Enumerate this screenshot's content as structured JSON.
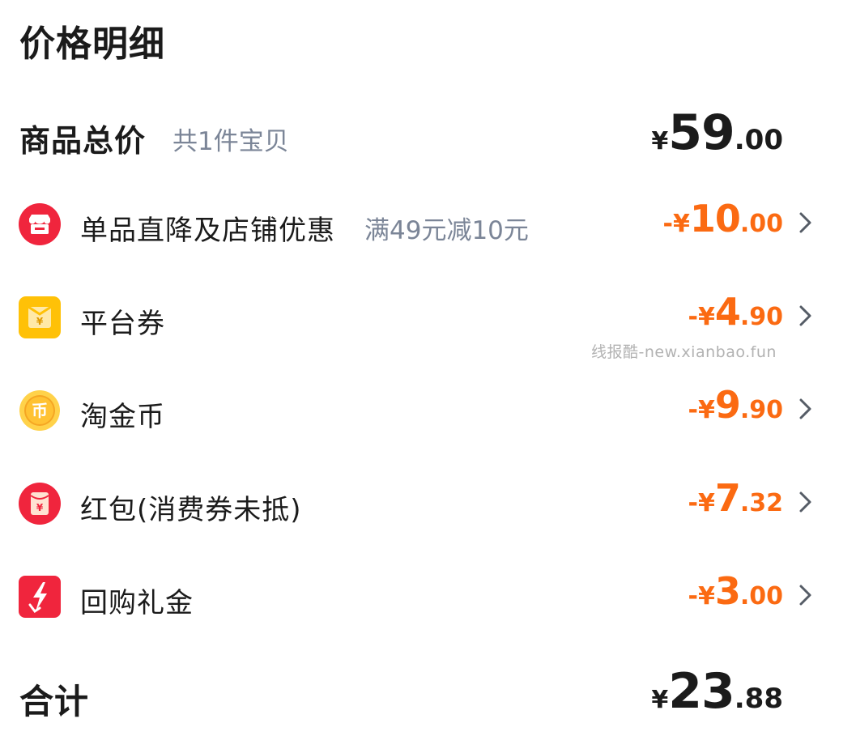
{
  "title": "价格明细",
  "subtotal": {
    "label": "商品总价",
    "count_text": "共1件宝贝",
    "currency": "¥",
    "int": "59",
    "dec": ".00"
  },
  "discounts": [
    {
      "icon": "shop-icon",
      "label": "单品直降及店铺优惠",
      "sub": "满49元减10元",
      "sign": "-¥",
      "int": "10",
      "dec": ".00"
    },
    {
      "icon": "coupon-icon",
      "label": "平台券",
      "sub": "",
      "sign": "-¥",
      "int": "4",
      "dec": ".90"
    },
    {
      "icon": "gold-coin-icon",
      "label": "淘金币",
      "sub": "",
      "sign": "-¥",
      "int": "9",
      "dec": ".90"
    },
    {
      "icon": "red-envelope-icon",
      "label": "红包(消费券未抵)",
      "sub": "",
      "sign": "-¥",
      "int": "7",
      "dec": ".32"
    },
    {
      "icon": "cashback-icon",
      "label": "回购礼金",
      "sub": "",
      "sign": "-¥",
      "int": "3",
      "dec": ".00"
    }
  ],
  "total": {
    "label": "合计",
    "currency": "¥",
    "int": "23",
    "dec": ".88"
  },
  "watermark": "线报酷-new.xianbao.fun",
  "colors": {
    "discount": "#fb6a12",
    "text": "#1b1b1b",
    "muted": "#7b8597",
    "red": "#f0253d",
    "yellow": "#ffc107"
  }
}
